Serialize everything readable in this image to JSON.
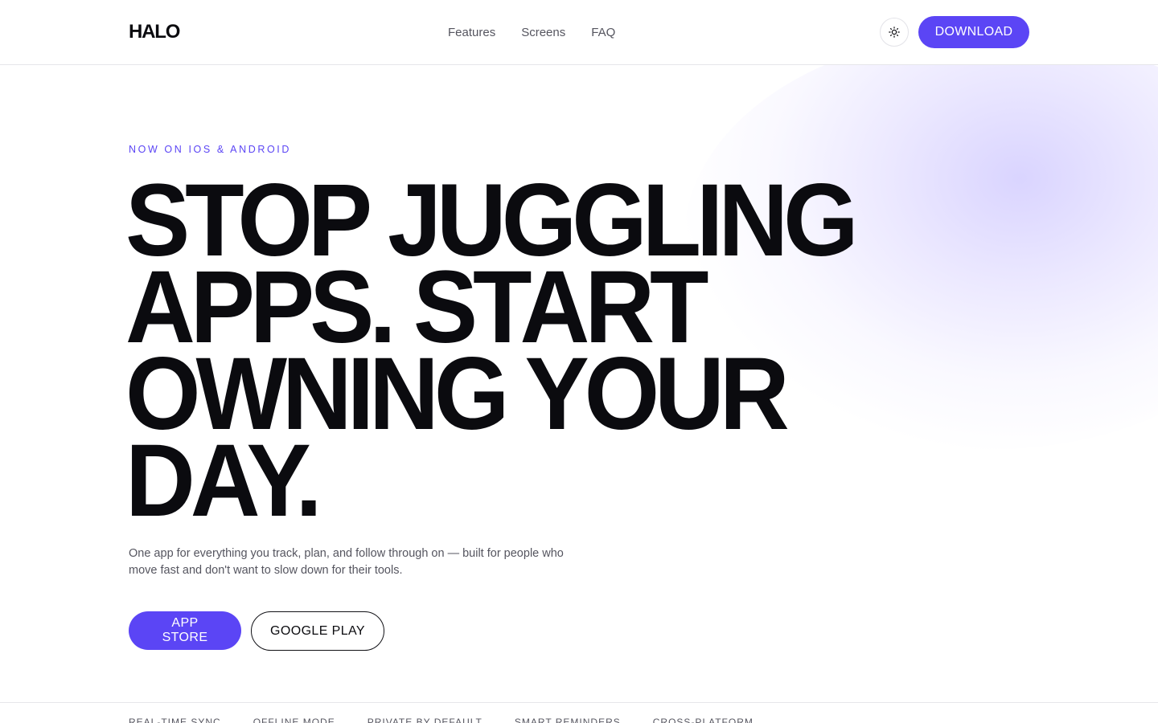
{
  "header": {
    "logo": "HALO",
    "nav": [
      "Features",
      "Screens",
      "FAQ"
    ],
    "theme_icon": "sun-icon",
    "download_label": "DOWNLOAD"
  },
  "hero": {
    "eyebrow": "NOW ON IOS & ANDROID",
    "headline_lines": [
      "STOP JUGGLING",
      "APPS. START",
      "OWNING YOUR",
      "DAY."
    ],
    "subtext": "One app for everything you track, plan, and follow through on — built for people who move fast and don't want to slow down for their tools.",
    "app_store_label": "APP STORE",
    "google_play_label": "GOOGLE PLAY"
  },
  "features_strip": [
    "REAL-TIME SYNC",
    "OFFLINE MODE",
    "PRIVATE BY DEFAULT",
    "SMART REMINDERS",
    "CROSS-PLATFORM"
  ],
  "colors": {
    "accent": "#5b45f5",
    "text": "#0b0b0f",
    "muted": "#55555f",
    "glow": "#d6d0ff"
  }
}
